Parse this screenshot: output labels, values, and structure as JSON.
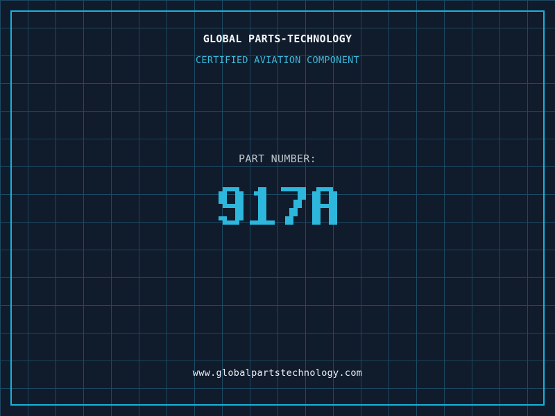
{
  "header": {
    "title": "GLOBAL PARTS-TECHNOLOGY",
    "subtitle": "CERTIFIED AVIATION COMPONENT"
  },
  "part": {
    "label": "PART NUMBER:",
    "number": "917A"
  },
  "footer": {
    "url": "www.globalpartstechnology.com"
  },
  "colors": {
    "background": "#101b2c",
    "grid_line": "#1c4a63",
    "frame": "#16b3dc",
    "title": "#f4f7fa",
    "subtitle": "#3cb9da",
    "part_label": "#b9c2cb",
    "part_number": "#2db7dc",
    "footer_text": "#eaf0f5"
  }
}
